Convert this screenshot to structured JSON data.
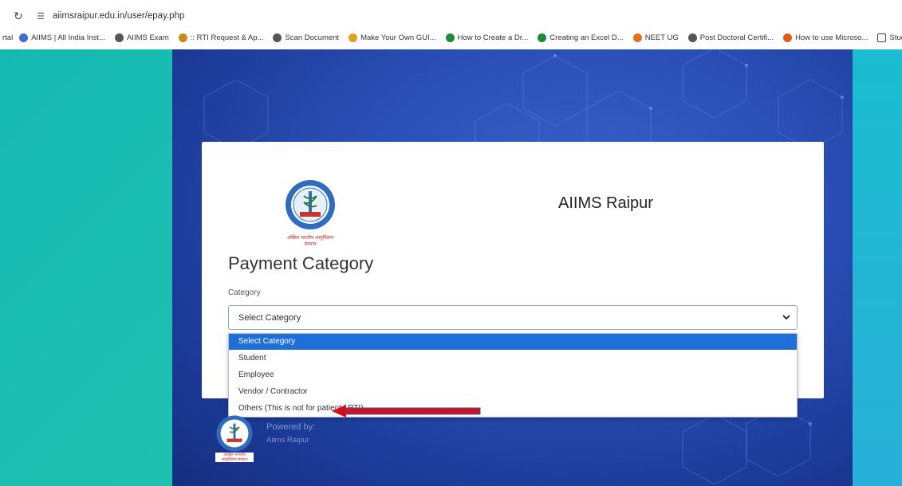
{
  "browser": {
    "url": "aiimsraipur.edu.in/user/epay.php",
    "reload_icon": "reload-icon",
    "site_info_icon": "site-info-icon"
  },
  "bookmarks": [
    {
      "label": "rtal"
    },
    {
      "label": "AIIMS | All India Inst...",
      "color": "#3d6fd6"
    },
    {
      "label": "AIIMS Exam",
      "color": "#555555"
    },
    {
      "label": ":: RTI Request & Ap...",
      "color": "#c98a1a"
    },
    {
      "label": "Scan Document",
      "color": "#555555"
    },
    {
      "label": "Make Your Own GUI...",
      "color": "#e0a020"
    },
    {
      "label": "How to Create a Dr...",
      "color": "#1f8a3a"
    },
    {
      "label": "Creating an Excel D...",
      "color": "#1f8a3a"
    },
    {
      "label": "NEET UG",
      "color": "#e07020"
    },
    {
      "label": "Post Doctoral Certifi...",
      "color": "#555555"
    },
    {
      "label": "How to use Microso...",
      "color": "#e05a1a"
    },
    {
      "label": "Student Informatio...",
      "color": "#ffffff"
    }
  ],
  "page": {
    "org_title": "AIIMS Raipur",
    "logo_caption": "अखिल भारतीय आयुर्विज्ञान संस्थान",
    "heading": "Payment Category",
    "category_label": "Category",
    "select_value": "Select Category",
    "options": [
      {
        "label": "Select Category",
        "selected": true
      },
      {
        "label": "Student",
        "selected": false
      },
      {
        "label": "Employee",
        "selected": false
      },
      {
        "label": "Vendor / Contractor",
        "selected": false
      },
      {
        "label": "Others (This is not for patient / RTI)",
        "selected": false
      }
    ],
    "powered_by": "Powered by:",
    "powered_org": "Aiims Raipur"
  },
  "colors": {
    "accent": "#1f6fd8",
    "annotation_arrow": "#d0101a"
  }
}
